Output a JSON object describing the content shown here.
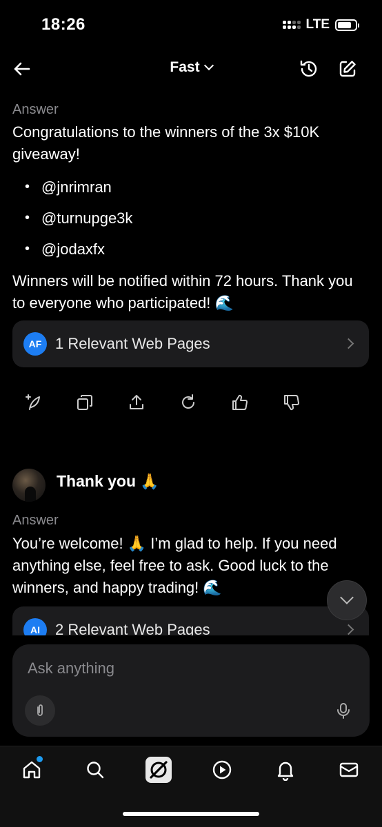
{
  "status_bar": {
    "time": "18:26",
    "network": "LTE"
  },
  "header": {
    "title": "Fast"
  },
  "answer1": {
    "label": "Answer",
    "intro": "Congratulations to the winners of the 3x $10K giveaway!",
    "winners": [
      "@jnrimran",
      "@turnupge3k",
      "@jodaxfx"
    ],
    "outro": "Winners will be notified within 72 hours. Thank you to everyone who participated!",
    "outro_emoji": "🌊",
    "web_pages": {
      "badge": "AF",
      "label": "1 Relevant Web Pages"
    }
  },
  "actions": [
    "regenerate-icon",
    "copy-icon",
    "share-icon",
    "refresh-icon",
    "thumbs-up-icon",
    "thumbs-down-icon"
  ],
  "user_message": {
    "text": "Thank you",
    "emoji": "🙏"
  },
  "answer2": {
    "label": "Answer",
    "text_part1": "You’re welcome!",
    "emoji1": "🙏",
    "text_part2": "I’m glad to help. If you need anything else, feel free to ask. Good luck to the winners, and happy trading!",
    "emoji2": "🌊",
    "web_pages": {
      "badge": "AI",
      "label": "2 Relevant Web Pages"
    }
  },
  "composer": {
    "placeholder": "Ask anything"
  },
  "tabs": [
    "home-icon",
    "search-icon",
    "grok-icon",
    "play-icon",
    "notifications-icon",
    "messages-icon"
  ],
  "colors": {
    "background": "#000000",
    "surface": "#1c1c1e",
    "accent": "#1d9bf0",
    "muted_text": "#8a8a8e"
  }
}
